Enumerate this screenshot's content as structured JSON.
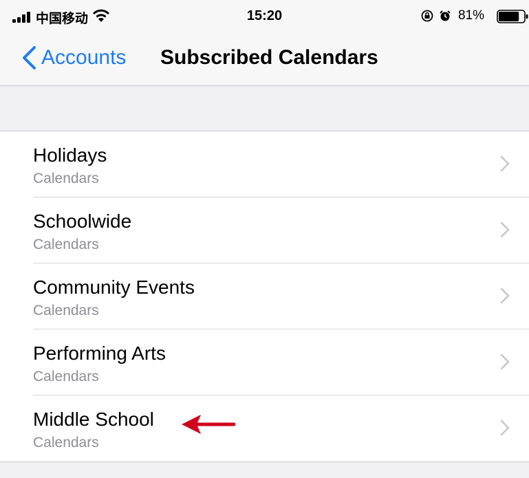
{
  "status_bar": {
    "carrier": "中国移动",
    "time": "15:20",
    "battery_percent": "81%",
    "battery_level": 0.81,
    "icons": [
      "signal-icon",
      "wifi-icon",
      "rotation-lock-icon",
      "alarm-icon",
      "battery-icon"
    ]
  },
  "nav": {
    "back_label": "Accounts",
    "title": "Subscribed Calendars"
  },
  "list": {
    "items": [
      {
        "title": "Holidays",
        "subtitle": "Calendars"
      },
      {
        "title": "Schoolwide",
        "subtitle": "Calendars"
      },
      {
        "title": "Community Events",
        "subtitle": "Calendars"
      },
      {
        "title": "Performing Arts",
        "subtitle": "Calendars"
      },
      {
        "title": "Middle School",
        "subtitle": "Calendars"
      }
    ]
  },
  "colors": {
    "accent": "#1b7cf4",
    "annotation_arrow": "#d0021b",
    "background": "#efeff4"
  }
}
